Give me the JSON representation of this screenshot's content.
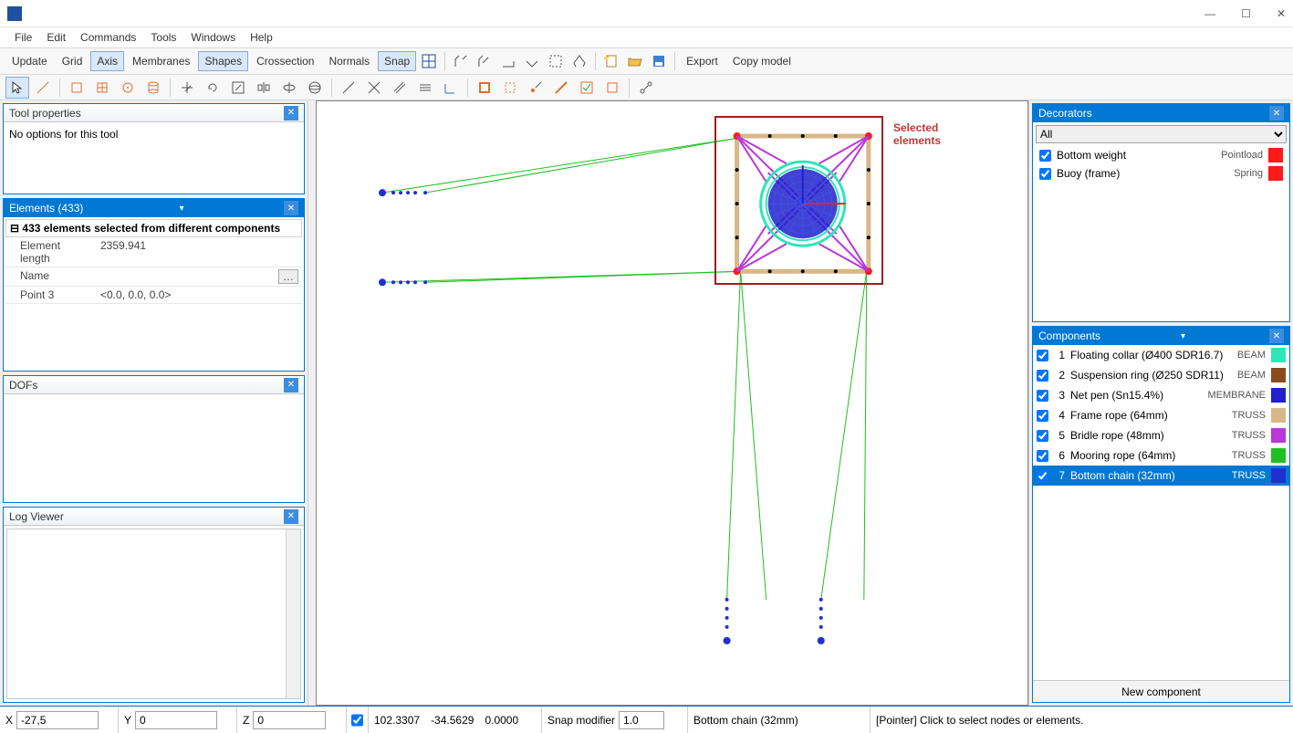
{
  "titlebar": {
    "title": ""
  },
  "menubar": [
    "File",
    "Edit",
    "Commands",
    "Tools",
    "Windows",
    "Help"
  ],
  "toolbar1": {
    "buttons": [
      "Update",
      "Grid",
      "Axis",
      "Membranes",
      "Shapes",
      "Crossection",
      "Normals",
      "Snap"
    ],
    "pressed": {
      "Axis": true,
      "Shapes": true,
      "Snap": true
    },
    "right_buttons": [
      "Export",
      "Copy model"
    ]
  },
  "panels": {
    "tool_properties": {
      "title": "Tool properties",
      "text": "No options for this tool"
    },
    "elements": {
      "title": "Elements (433)",
      "header": "433 elements selected from different components",
      "rows": [
        {
          "k": "Element length",
          "v": "2359.941"
        },
        {
          "k": "Name",
          "v": ""
        },
        {
          "k": "Point 3",
          "v": "<0.0, 0.0, 0.0>"
        }
      ]
    },
    "dofs": {
      "title": "DOFs"
    },
    "log": {
      "title": "Log Viewer"
    }
  },
  "decorators": {
    "title": "Decorators",
    "filter": "All",
    "items": [
      {
        "name": "Bottom weight",
        "type": "Pointload",
        "color": "#ff1a1a"
      },
      {
        "name": "Buoy (frame)",
        "type": "Spring",
        "color": "#ff1a1a"
      }
    ]
  },
  "components": {
    "title": "Components",
    "items": [
      {
        "num": 1,
        "name": "Floating collar (Ø400 SDR16.7)",
        "type": "BEAM",
        "color": "#2ee6b8",
        "selected": false
      },
      {
        "num": 2,
        "name": "Suspension ring (Ø250 SDR11)",
        "type": "BEAM",
        "color": "#8b4a1e",
        "selected": false
      },
      {
        "num": 3,
        "name": "Net pen (Sn15.4%)",
        "type": "MEMBRANE",
        "color": "#2020cc",
        "selected": false
      },
      {
        "num": 4,
        "name": "Frame rope (64mm)",
        "type": "TRUSS",
        "color": "#d8b888",
        "selected": false
      },
      {
        "num": 5,
        "name": "Bridle rope (48mm)",
        "type": "TRUSS",
        "color": "#b838d8",
        "selected": false
      },
      {
        "num": 6,
        "name": "Mooring rope (64mm)",
        "type": "TRUSS",
        "color": "#20c020",
        "selected": false
      },
      {
        "num": 7,
        "name": "Bottom chain (32mm)",
        "type": "TRUSS",
        "color": "#2030d0",
        "selected": true
      }
    ],
    "new_btn": "New component"
  },
  "status": {
    "X": "X",
    "Xv": "-27,5",
    "Y": "Y",
    "Yv": "0",
    "Z": "Z",
    "Zv": "0",
    "coords": [
      "102.3307",
      "-34.5629",
      "0.0000"
    ],
    "snap_label": "Snap modifier",
    "snap_value": "1.0",
    "component": "Bottom chain (32mm)",
    "hint": "[Pointer] Click to select nodes or elements."
  },
  "annotation": {
    "line1": "Selected",
    "line2": "elements"
  }
}
